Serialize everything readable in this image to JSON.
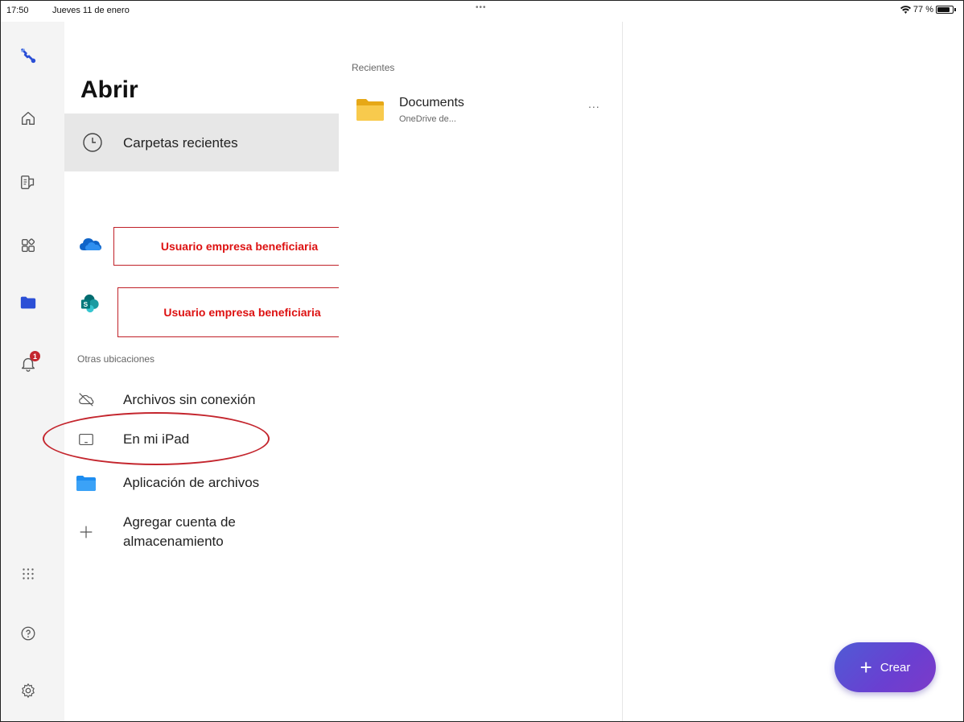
{
  "status_bar": {
    "time": "17:50",
    "date": "Jueves 11 de enero",
    "multitask_dots": "•••",
    "battery": "77 %"
  },
  "rail": {
    "items": [
      {
        "name": "tools-icon"
      },
      {
        "name": "home-icon"
      },
      {
        "name": "create-document-icon"
      },
      {
        "name": "apps-icon"
      },
      {
        "name": "folder-icon"
      },
      {
        "name": "notifications-icon",
        "badge": "1"
      },
      {
        "name": "app-launcher-icon"
      },
      {
        "name": "help-icon"
      },
      {
        "name": "settings-icon"
      }
    ],
    "active_color": "#2b4fd6"
  },
  "open_panel": {
    "title": "Abrir",
    "recent_folders_label": "Carpetas recientes",
    "accounts": [
      {
        "service": "onedrive",
        "label": "Usuario empresa beneficiaria"
      },
      {
        "service": "sharepoint",
        "label": "Usuario empresa beneficiaria"
      }
    ],
    "other_locations_label": "Otras ubicaciones",
    "locations": [
      {
        "label": "Archivos sin conexión",
        "icon": "cloud-off-icon"
      },
      {
        "label": "En mi iPad",
        "icon": "ipad-icon"
      },
      {
        "label": "Aplicación de archivos",
        "icon": "files-app-icon"
      },
      {
        "label": "Agregar cuenta de almacenamiento",
        "icon": "plus-icon"
      }
    ]
  },
  "recents_panel": {
    "header": "Recientes",
    "files": [
      {
        "name": "Documents",
        "location": "OneDrive de...",
        "more": "..."
      }
    ]
  },
  "create_button": {
    "label": "Crear"
  },
  "colors": {
    "annotation_red": "#c4262e",
    "selected_row_bg": "#e7e7e7",
    "create_gradient_start": "#4f5bd5",
    "create_gradient_end": "#7d3ac8"
  }
}
